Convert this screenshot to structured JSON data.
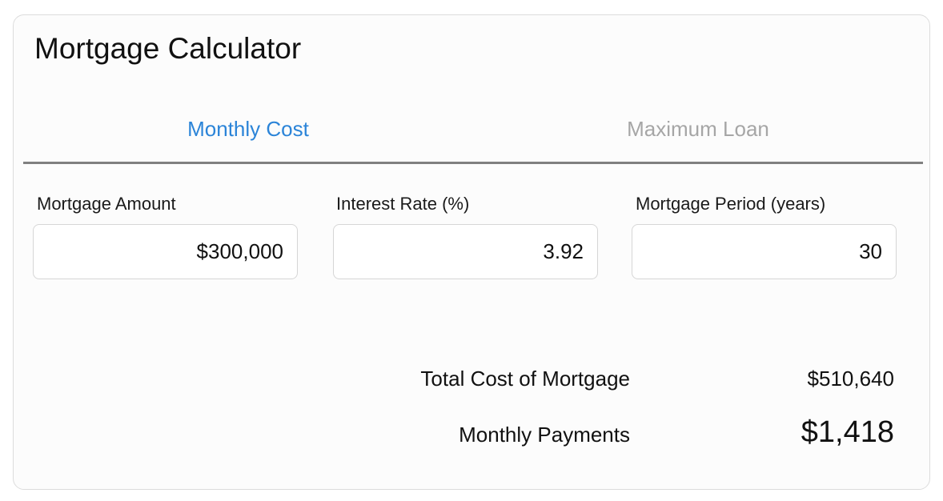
{
  "calculator": {
    "title": "Mortgage Calculator",
    "tabs": [
      {
        "label": "Monthly Cost",
        "active": true
      },
      {
        "label": "Maximum Loan",
        "active": false
      }
    ],
    "fields": {
      "amount": {
        "label": "Mortgage Amount",
        "value": "$300,000"
      },
      "rate": {
        "label": "Interest Rate (%)",
        "value": "3.92"
      },
      "period": {
        "label": "Mortgage Period (years)",
        "value": "30"
      }
    },
    "results": {
      "total_cost": {
        "label": "Total Cost of Mortgage",
        "value": "$510,640"
      },
      "monthly_payment": {
        "label": "Monthly Payments",
        "value": "$1,418"
      }
    }
  },
  "colors": {
    "accent": "#2b84d8",
    "inactive_tab": "#a6a6a6",
    "divider": "#808080",
    "border": "#dcdcdc"
  }
}
